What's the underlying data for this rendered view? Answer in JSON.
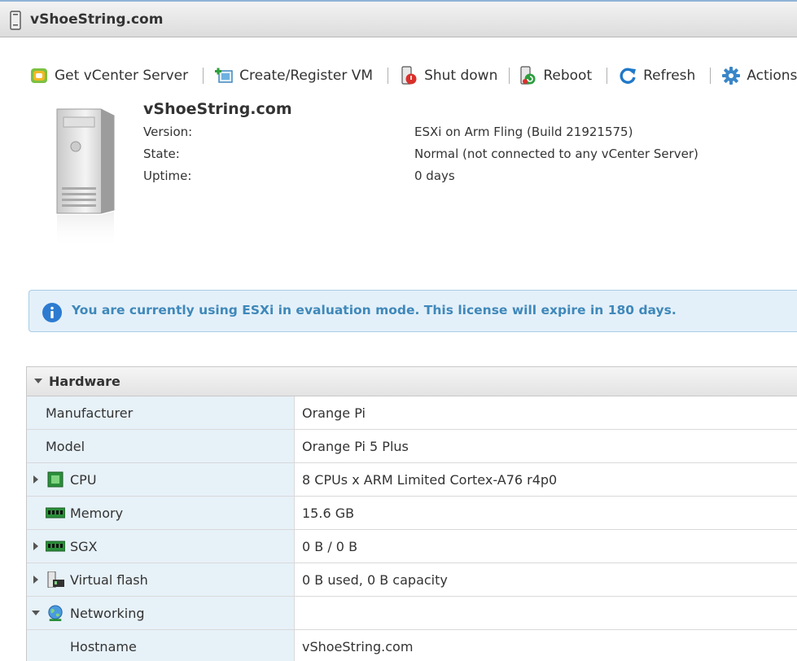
{
  "window": {
    "title": "vShoeString.com"
  },
  "toolbar": {
    "items": [
      {
        "label": "Get vCenter Server",
        "icon": "vcenter-icon"
      },
      {
        "label": "Create/Register VM",
        "icon": "create-vm-icon"
      },
      {
        "label": "Shut down",
        "icon": "shutdown-icon"
      },
      {
        "label": "Reboot",
        "icon": "reboot-icon"
      },
      {
        "label": "Refresh",
        "icon": "refresh-icon"
      },
      {
        "label": "Actions",
        "icon": "gear-icon"
      }
    ]
  },
  "summary": {
    "host_name": "vShoeString.com",
    "rows": [
      {
        "label": "Version:",
        "value": "ESXi on Arm Fling (Build 21921575)"
      },
      {
        "label": "State:",
        "value": "Normal (not connected to any vCenter Server)"
      },
      {
        "label": "Uptime:",
        "value": "0 days"
      }
    ]
  },
  "banner": {
    "message": "You are currently using ESXi in evaluation mode. This license will expire in 180 days.",
    "icon": "info-icon"
  },
  "hardware": {
    "title": "Hardware",
    "rows": [
      {
        "label": "Manufacturer",
        "value": "Orange Pi"
      },
      {
        "label": "Model",
        "value": "Orange Pi 5 Plus"
      },
      {
        "label": "CPU",
        "value": "8 CPUs x ARM Limited Cortex-A76 r4p0",
        "icon": "cpu-icon"
      },
      {
        "label": "Memory",
        "value": "15.6 GB",
        "icon": "memory-icon"
      },
      {
        "label": "SGX",
        "value": "0 B / 0 B",
        "icon": "memory-icon"
      },
      {
        "label": "Virtual flash",
        "value": "0 B used, 0 B capacity",
        "icon": "virtual-flash-icon"
      },
      {
        "label": "Networking",
        "value": "",
        "icon": "network-globe-icon"
      },
      {
        "label": "Hostname",
        "value": "vShoeString.com"
      }
    ]
  },
  "colors": {
    "banner_text": "#3f88ba",
    "banner_bg": "#e4f0f9",
    "label_bg": "#e7f1f8"
  }
}
